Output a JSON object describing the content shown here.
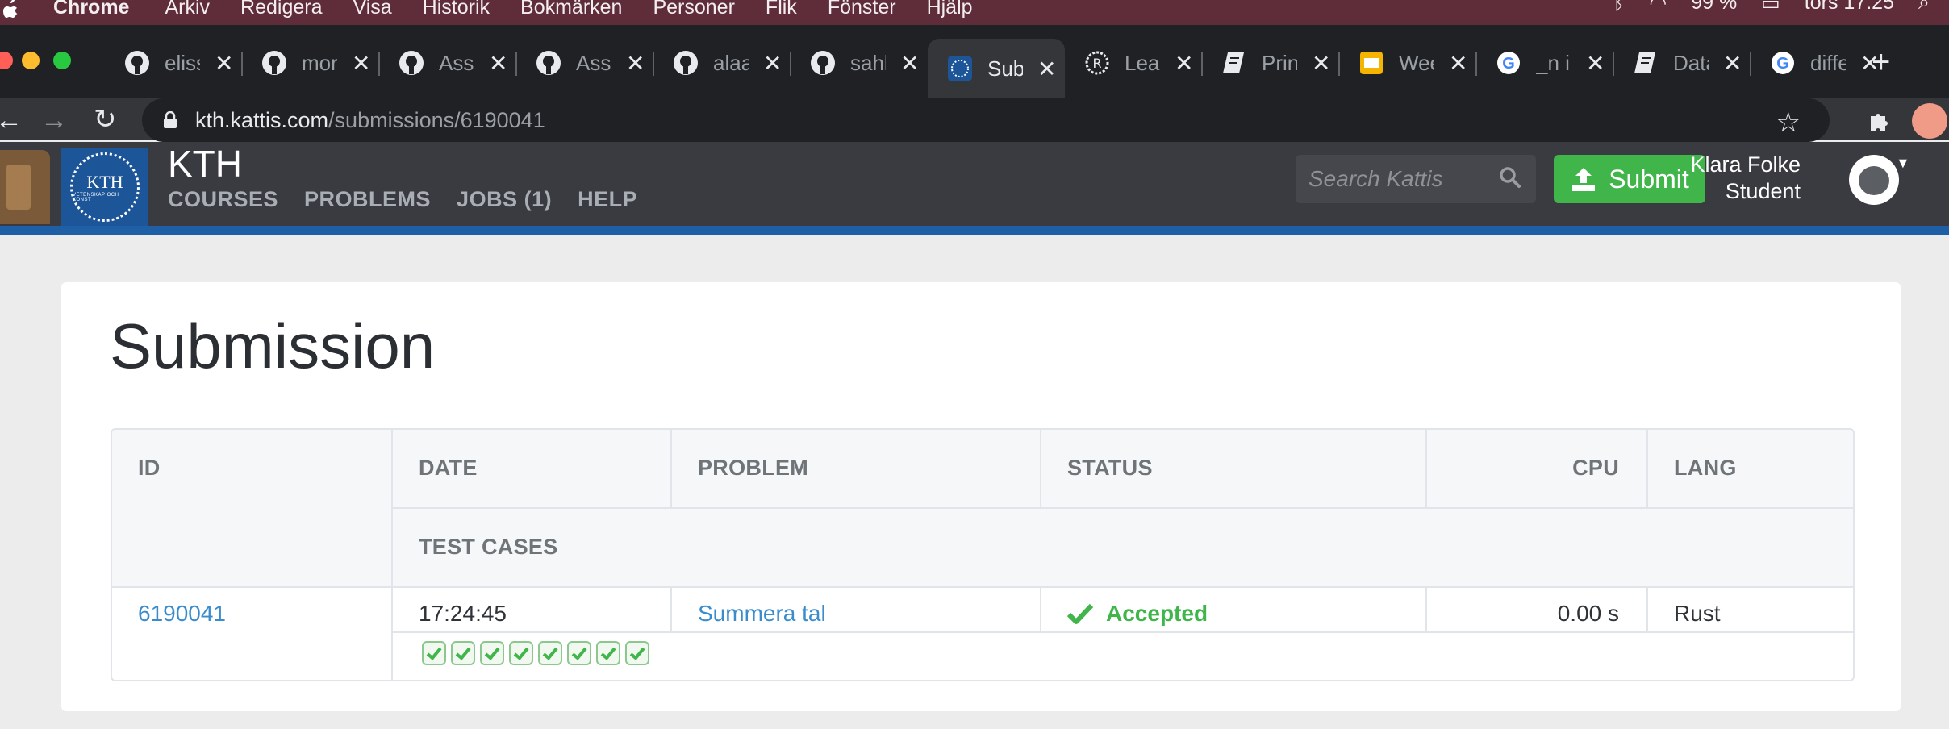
{
  "menubar": {
    "app": "Chrome",
    "items": [
      "Arkiv",
      "Redigera",
      "Visa",
      "Historik",
      "Bokmärken",
      "Personer",
      "Flik",
      "Fönster",
      "Hjälp"
    ],
    "battery": "99 %",
    "clock": "tors 17:25"
  },
  "tabs": [
    {
      "title": "eliss",
      "icon": "github-icon"
    },
    {
      "title": "mor",
      "icon": "github-icon"
    },
    {
      "title": "Ass",
      "icon": "github-icon"
    },
    {
      "title": "Ass",
      "icon": "github-icon"
    },
    {
      "title": "alaa",
      "icon": "github-icon"
    },
    {
      "title": "sahl",
      "icon": "github-icon"
    },
    {
      "title": "Sub",
      "icon": "kth-icon",
      "active": true
    },
    {
      "title": "Lea",
      "icon": "rust-icon"
    },
    {
      "title": "Prin",
      "icon": "doc-icon"
    },
    {
      "title": "Wee",
      "icon": "slides-icon"
    },
    {
      "title": "_n ir",
      "icon": "google-icon"
    },
    {
      "title": "Data",
      "icon": "doc-icon"
    },
    {
      "title": "diffe",
      "icon": "google-icon"
    }
  ],
  "address": {
    "host": "kth.kattis.com",
    "path": "/submissions/6190041"
  },
  "site": {
    "title": "KTH",
    "logo_text": "KTH",
    "logo_sub": "VETENSKAP OCH KONST",
    "nav": [
      "COURSES",
      "PROBLEMS",
      "JOBS (1)",
      "HELP"
    ],
    "search_placeholder": "Search Kattis",
    "submit_label": "Submit",
    "user_name": "Klara Folke",
    "user_role": "Student"
  },
  "page": {
    "title": "Submission"
  },
  "table": {
    "headers": {
      "id": "ID",
      "date": "DATE",
      "problem": "PROBLEM",
      "status": "STATUS",
      "cpu": "CPU",
      "lang": "LANG",
      "test_cases": "TEST CASES"
    },
    "row": {
      "id": "6190041",
      "date": "17:24:45",
      "problem": "Summera tal",
      "status": "Accepted",
      "cpu": "0.00 s",
      "lang": "Rust",
      "test_cases_passed": 8
    }
  },
  "colors": {
    "accent_green": "#3fb54a",
    "link_blue": "#3a8ccd",
    "header_dark": "#3a3b41",
    "kth_blue": "#1d5599"
  }
}
